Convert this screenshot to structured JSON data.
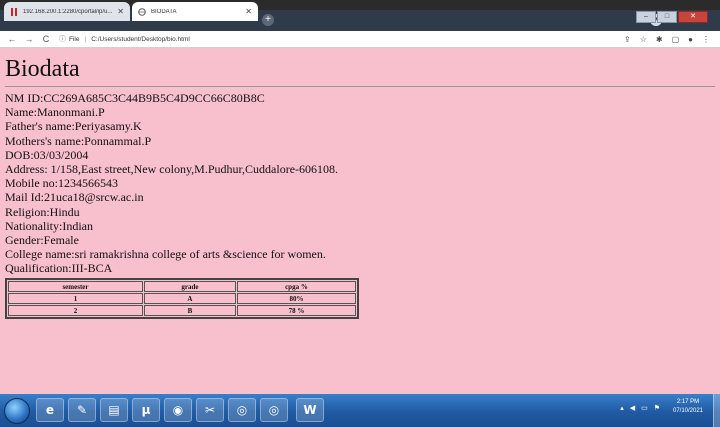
{
  "browser": {
    "tabs": [
      {
        "title": "192.168.200.1:2280/cportal/ip/u...",
        "active": false
      },
      {
        "title": "BIODATA",
        "active": true
      }
    ],
    "url_label": "File",
    "url": "C:/Users/student/Desktop/bio.html",
    "icons": [
      "back-icon",
      "forward-icon",
      "reload-icon",
      "info-icon",
      "share-icon",
      "star-icon",
      "extensions-icon",
      "sidepanel-icon",
      "profile-icon",
      "menu-icon"
    ]
  },
  "page": {
    "heading": "Biodata",
    "lines": [
      "NM ID:CC269A685C3C44B9B5C4D9CC66C80B8C",
      "Name:Manonmani.P",
      "Father's name:Periyasamy.K",
      "Mothers's name:Ponnammal.P",
      "DOB:03/03/2004",
      "Address: 1/158,East street,New colony,M.Pudhur,Cuddalore-606108.",
      "Mobile no:1234566543",
      "Mail Id:21uca18@srcw.ac.in",
      "Religion:Hindu",
      "Nationality:Indian",
      "Gender:Female",
      "College name:sri ramakrishna college of arts &science for women.",
      "Qualification:III-BCA"
    ],
    "table": {
      "headers": [
        "semester",
        "grade",
        "cpga %"
      ],
      "rows": [
        [
          "1",
          "A",
          "80%"
        ],
        [
          "2",
          "B",
          "78 %"
        ]
      ]
    },
    "bg_color": "#f8c0cc"
  },
  "taskbar": {
    "apps": [
      "ie-icon",
      "paint-icon",
      "explorer-icon",
      "utorrent-icon",
      "media-icon",
      "tool-icon",
      "chrome-icon",
      "chrome-icon",
      "word-icon"
    ],
    "time": "2:17 PM",
    "date": "07/10/2021"
  }
}
